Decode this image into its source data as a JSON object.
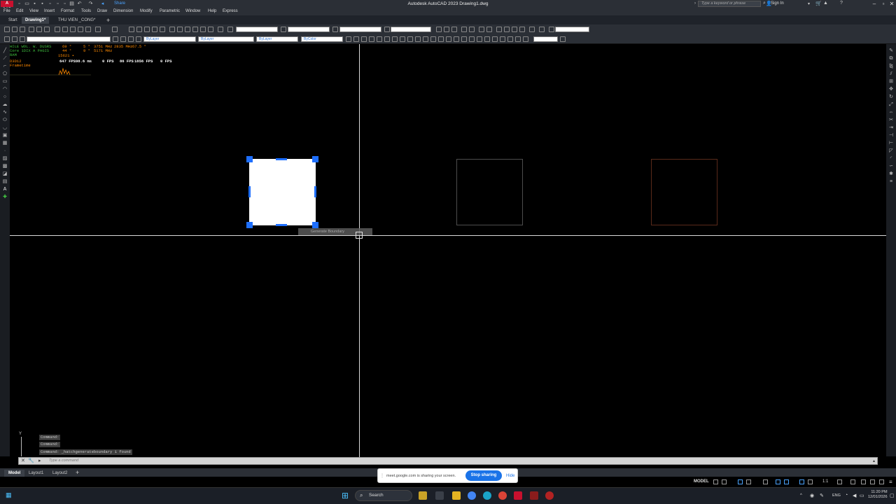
{
  "app": {
    "logo": "A CAD",
    "window_title": "Autodesk AutoCAD 2023    Drawing1.dwg",
    "share_label": "Share",
    "search_placeholder": "Type a keyword or phrase",
    "sign_in": "Sign In"
  },
  "menu": [
    "File",
    "Edit",
    "View",
    "Insert",
    "Format",
    "Tools",
    "Draw",
    "Dimension",
    "Modify",
    "Parametric",
    "Window",
    "Help",
    "Express"
  ],
  "doc_tabs": [
    {
      "label": "Start",
      "active": false
    },
    {
      "label": "Drawing1*",
      "active": true
    },
    {
      "label": "THU VIEN _CONG*",
      "active": false
    }
  ],
  "toolbar": {
    "layer_combo": "ByLayer",
    "linetype_combo": "ByLayer",
    "lineweight_combo": "ByLayer",
    "color_combo": "ByColor"
  },
  "perf_overlay": {
    "lines_left": [
      "HILE WOL. W. DUSRS",
      "Core 1DIX A PAGIS",
      "RAM",
      "D3D12",
      "Frametime"
    ],
    "col1": [
      "69 °",
      "44 °",
      "15621 ▪"
    ],
    "col2": [
      "5 °",
      "9 °"
    ],
    "col3": [
      "3751 MHz",
      "5171 MHz"
    ],
    "col4": [
      "2835 MHz",
      "67.5 °"
    ],
    "row2": [
      "647 FPS",
      "98.6 ms",
      "0 FPS",
      "86 FPS",
      "1856 FPS",
      "0 FPS"
    ]
  },
  "tooltip": "Generate Boundary",
  "command_history": [
    "Command:",
    "Command:",
    "Command: _hatchgenerateboundary 1 found"
  ],
  "command_placeholder": "Type a command",
  "ucs_label": "Y",
  "layout_tabs": [
    {
      "label": "Model",
      "active": true
    },
    {
      "label": "Layout1",
      "active": false
    },
    {
      "label": "Layout2",
      "active": false
    }
  ],
  "status": {
    "model": "MODEL",
    "scale": "1:1"
  },
  "share_banner": {
    "text": "meet.google.com is sharing your screen.",
    "stop": "Stop sharing",
    "hide": "Hide"
  },
  "taskbar": {
    "search": "Search",
    "lang": "ENG",
    "time": "11:20 PM",
    "date": "12/01/2026"
  },
  "colors": {
    "accent": "#1e6fff",
    "share_button": "#1a73e8",
    "perf_green": "#3fbf3f",
    "perf_orange": "#ff8a00"
  }
}
